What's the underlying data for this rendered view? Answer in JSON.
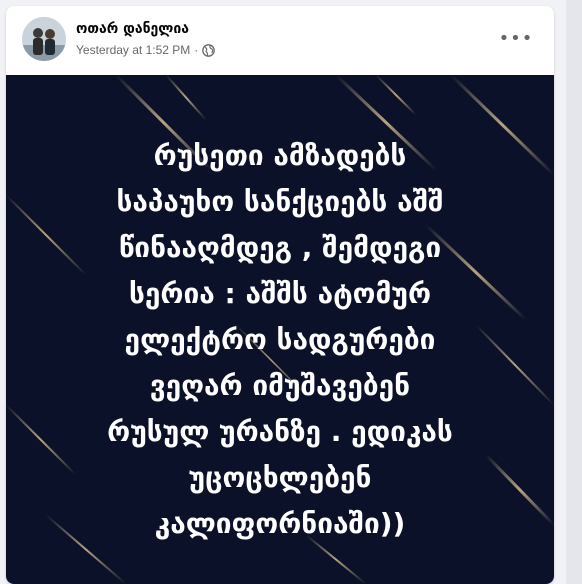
{
  "post": {
    "author": "ოთარ დანელია",
    "timestamp": "Yesterday at 1:52 PM",
    "separator": "·",
    "privacy_icon": "globe-icon",
    "more_label": "•••",
    "image_text": "რუსეთი ამზადებს\nსაპაუხო სანქციებს აშშ\nწინააღმდეგ , შემდეგი\nსერია : აშშს ატომურ\nელექტრო სადგურები\nვეღარ იმუშავებენ\nრუსულ ურანზე . ედიკას\nუცოცხლებენ\nკალიფორნიაში))"
  },
  "colors": {
    "photo_background": "#0a1128",
    "streak": "#c9b48a",
    "author_text": "#050505",
    "meta_text": "#65676b"
  }
}
